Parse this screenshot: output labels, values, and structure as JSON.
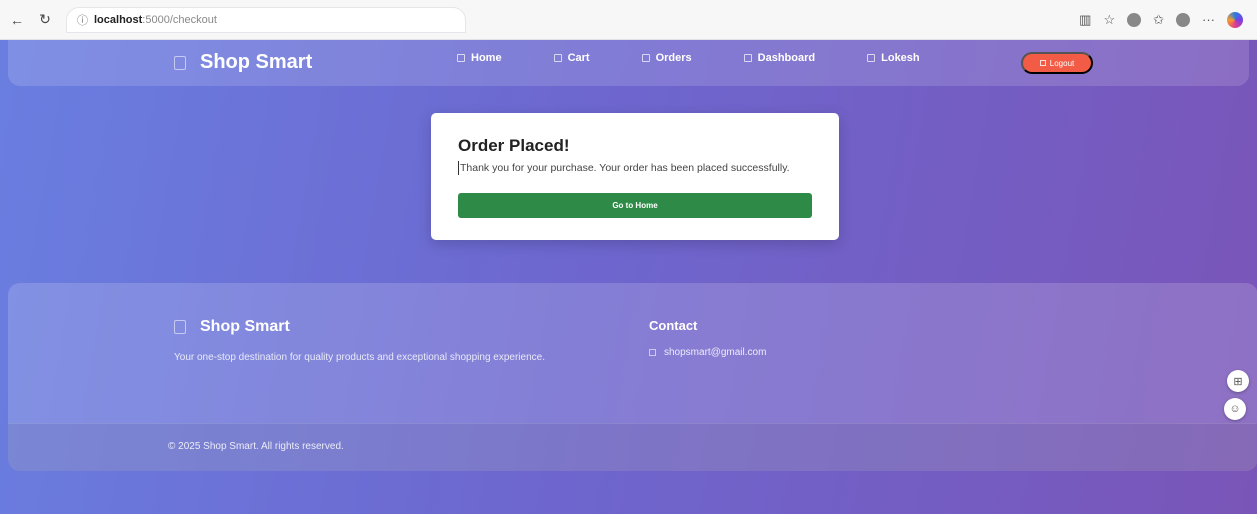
{
  "browser": {
    "host": "localhost",
    "path": ":5000/checkout"
  },
  "navbar": {
    "brand": "Shop Smart",
    "links": [
      {
        "label": "Home"
      },
      {
        "label": "Cart"
      },
      {
        "label": "Orders"
      },
      {
        "label": "Dashboard"
      },
      {
        "label": "Lokesh"
      }
    ],
    "logout_label": "Logout"
  },
  "modal": {
    "title": "Order Placed!",
    "message": "Thank you for your purchase. Your order has been placed successfully.",
    "button_label": "Go to Home"
  },
  "footer": {
    "brand": "Shop Smart",
    "description": "Your one-stop destination for quality products and exceptional shopping experience.",
    "contact_title": "Contact",
    "contact_email": "shopsmart@gmail.com",
    "copyright": "© 2025 Shop Smart. All rights reserved."
  },
  "colors": {
    "logout": "#f25b45",
    "primary_button": "#2e8b47"
  }
}
